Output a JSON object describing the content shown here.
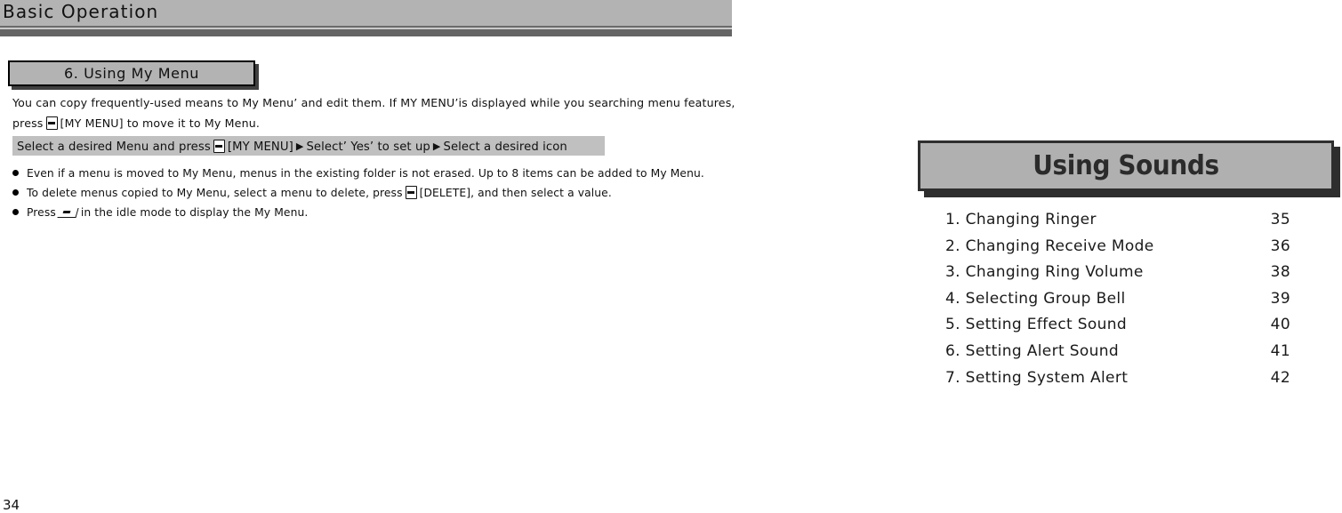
{
  "header": {
    "title": "Basic Operation"
  },
  "section": {
    "title": "6. Using My Menu"
  },
  "intro": {
    "line1_a": "You can copy frequently-used means to My Menu’ and edit them. If MY MENU’is displayed while you searching menu features,",
    "line2_a": "press",
    "line2_key_icon": "my-menu-key-icon",
    "line2_b": "[MY MENU] to move it to My Menu."
  },
  "procedure": {
    "part1": "Select a desired Menu and press",
    "key_icon": "my-menu-key-icon",
    "part2": "[MY MENU]",
    "arrow1": "▶",
    "part3": "Select’ Yes’ to set up",
    "arrow2": "▶",
    "part4": "Select a desired icon"
  },
  "notes": [
    {
      "bullet": "●",
      "text_a": "Even if a menu is moved to My Menu, menus in the existing folder is not erased. Up to 8 items can be added to My Menu.",
      "icon": null,
      "text_b": ""
    },
    {
      "bullet": "●",
      "text_a": "To delete menus copied to My Menu, select a menu to delete, press",
      "icon": "delete-key-icon",
      "text_b": "[DELETE], and then select a value."
    },
    {
      "bullet": "●",
      "text_a": "Press",
      "icon": "my-menu-slant-key-icon",
      "text_b": "in the idle mode to display the My Menu."
    }
  ],
  "sounds": {
    "title": "Using Sounds",
    "toc": [
      {
        "label": "1. Changing Ringer",
        "page": "35"
      },
      {
        "label": "2. Changing Receive Mode",
        "page": "36"
      },
      {
        "label": "3. Changing Ring Volume",
        "page": "38"
      },
      {
        "label": "4. Selecting Group Bell",
        "page": "39"
      },
      {
        "label": "5. Setting Effect Sound",
        "page": "40"
      },
      {
        "label": "6. Setting Alert Sound",
        "page": "41"
      },
      {
        "label": "7. Setting System Alert",
        "page": "42"
      }
    ]
  },
  "footer": {
    "page_number": "34"
  },
  "colors": {
    "header_band": "#b3b3b3",
    "rule_dark": "#656565",
    "section_box_fill": "#b3b3b3",
    "procedure_bar_fill": "#c0c0c0",
    "sounds_box_fill": "#b0b0b0",
    "sounds_box_border": "#2e2e2e"
  }
}
